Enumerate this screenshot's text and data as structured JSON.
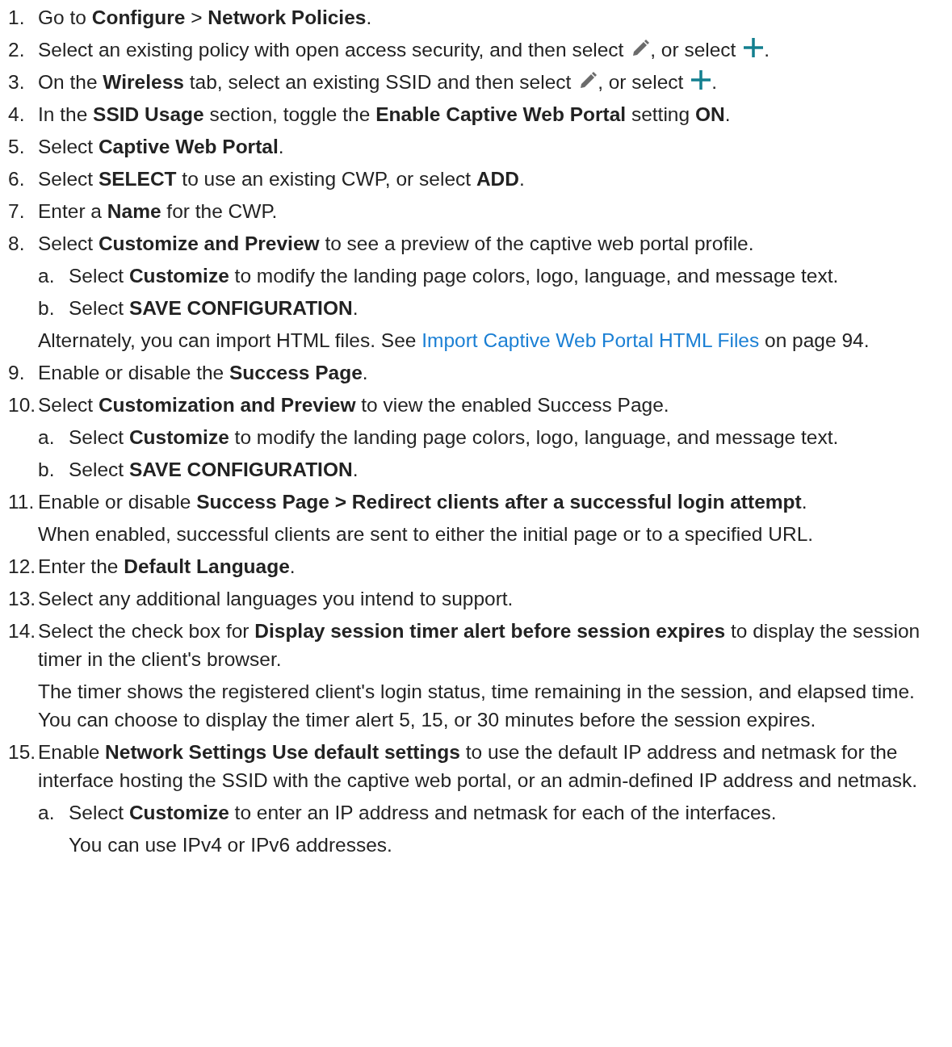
{
  "steps": [
    {
      "number": "1.",
      "parts": [
        {
          "kind": "text",
          "text": "Go to **Configure** > **Network Policies**."
        }
      ]
    },
    {
      "number": "2.",
      "parts": [
        {
          "kind": "text",
          "text": "Select an existing policy with open access security, and then select "
        },
        {
          "kind": "pencil"
        },
        {
          "kind": "text",
          "text": ", or select "
        },
        {
          "kind": "plus"
        },
        {
          "kind": "text",
          "text": "."
        }
      ]
    },
    {
      "number": "3.",
      "parts": [
        {
          "kind": "text",
          "text": "On the **Wireless** tab, select an existing SSID and then select "
        },
        {
          "kind": "pencil"
        },
        {
          "kind": "text",
          "text": ", or select "
        },
        {
          "kind": "plus"
        },
        {
          "kind": "text",
          "text": "."
        }
      ]
    },
    {
      "number": "4.",
      "parts": [
        {
          "kind": "text",
          "text": "In the **SSID Usage** section, toggle the **Enable Captive Web Portal** setting **ON**."
        }
      ]
    },
    {
      "number": "5.",
      "parts": [
        {
          "kind": "text",
          "text": "Select **Captive Web Portal**."
        }
      ]
    },
    {
      "number": "6.",
      "parts": [
        {
          "kind": "text",
          "text": "Select **SELECT** to use an existing CWP, or select **ADD**."
        }
      ]
    },
    {
      "number": "7.",
      "parts": [
        {
          "kind": "text",
          "text": "Enter a **Name** for the CWP."
        }
      ]
    },
    {
      "number": "8.",
      "parts": [
        {
          "kind": "text",
          "text": "Select **Customize and Preview** to see a preview of the captive web portal profile."
        }
      ],
      "blocks": [
        {
          "kind": "substep",
          "letter": "a.",
          "parts": [
            {
              "kind": "text",
              "text": "Select **Customize** to modify the landing page colors, logo, language, and message text."
            }
          ]
        },
        {
          "kind": "substep",
          "letter": "b.",
          "parts": [
            {
              "kind": "text",
              "text": "Select **SAVE CONFIGURATION**."
            }
          ]
        },
        {
          "kind": "note",
          "parts": [
            {
              "kind": "text",
              "text": "Alternately, you can import HTML files. See "
            },
            {
              "kind": "link",
              "text": "Import Captive Web Portal HTML Files"
            },
            {
              "kind": "text",
              "text": " on page 94."
            }
          ]
        }
      ]
    },
    {
      "number": "9.",
      "parts": [
        {
          "kind": "text",
          "text": "Enable or disable the **Success Page**."
        }
      ]
    },
    {
      "number": "10.",
      "parts": [
        {
          "kind": "text",
          "text": "Select **Customization and Preview** to view the enabled Success Page."
        }
      ],
      "blocks": [
        {
          "kind": "substep",
          "letter": "a.",
          "parts": [
            {
              "kind": "text",
              "text": "Select **Customize** to modify the landing page colors, logo, language, and message text."
            }
          ]
        },
        {
          "kind": "substep",
          "letter": "b.",
          "parts": [
            {
              "kind": "text",
              "text": "Select **SAVE CONFIGURATION**."
            }
          ]
        }
      ]
    },
    {
      "number": "11.",
      "parts": [
        {
          "kind": "text",
          "text": "Enable or disable **Success Page > Redirect clients after a successful login attempt**."
        }
      ],
      "blocks": [
        {
          "kind": "note",
          "parts": [
            {
              "kind": "text",
              "text": "When enabled, successful clients are sent to either the initial page or to a specified URL."
            }
          ]
        }
      ]
    },
    {
      "number": "12.",
      "parts": [
        {
          "kind": "text",
          "text": "Enter the **Default Language**."
        }
      ]
    },
    {
      "number": "13.",
      "parts": [
        {
          "kind": "text",
          "text": "Select any additional languages you intend to support."
        }
      ]
    },
    {
      "number": "14.",
      "parts": [
        {
          "kind": "text",
          "text": "Select the check box for **Display session timer alert before session expires** to display the session timer in the client's browser."
        }
      ],
      "blocks": [
        {
          "kind": "note",
          "parts": [
            {
              "kind": "text",
              "text": "The timer shows the registered client's login status, time remaining in the session, and elapsed time. You can choose to display the timer alert 5, 15, or 30 minutes before the session expires."
            }
          ]
        }
      ]
    },
    {
      "number": "15.",
      "parts": [
        {
          "kind": "text",
          "text": "Enable **Network Settings Use default settings** to use the default IP address and netmask for the interface hosting the SSID with the captive web portal, or an admin-defined IP address and netmask."
        }
      ],
      "blocks": [
        {
          "kind": "substep",
          "letter": "a.",
          "parts": [
            {
              "kind": "text",
              "text": "Select **Customize** to enter an IP address and netmask for each of the interfaces."
            }
          ],
          "notes": [
            {
              "parts": [
                {
                  "kind": "text",
                  "text": "You can use IPv4 or IPv6 addresses."
                }
              ]
            }
          ]
        }
      ]
    }
  ]
}
